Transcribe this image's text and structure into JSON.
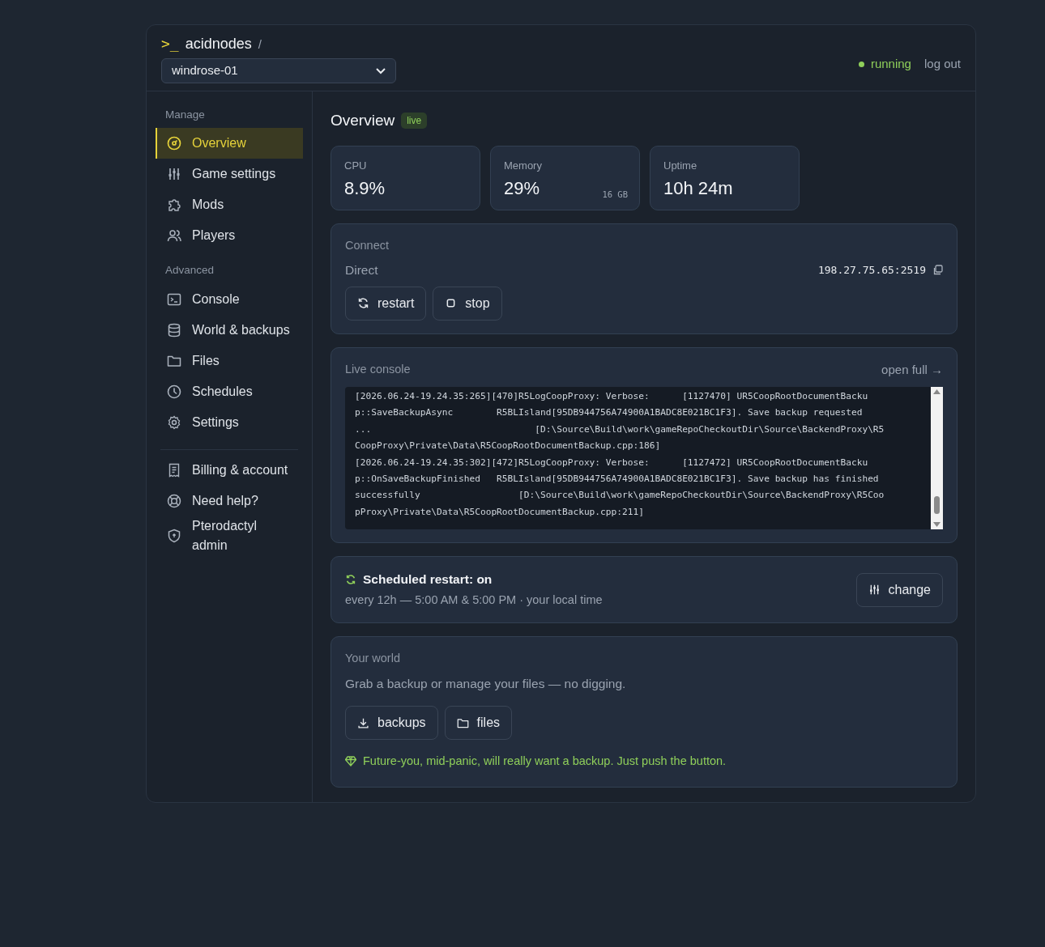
{
  "brand": {
    "prompt": ">_",
    "name": "acidnodes",
    "separator": "/"
  },
  "server_select": {
    "value": "windrose-01"
  },
  "header": {
    "status": "running",
    "logout": "log out"
  },
  "sidebar": {
    "sections": [
      {
        "title": "Manage",
        "items": [
          {
            "label": "Overview",
            "selected": true
          },
          {
            "label": "Game settings",
            "selected": false
          },
          {
            "label": "Mods",
            "selected": false
          },
          {
            "label": "Players",
            "selected": false
          }
        ]
      },
      {
        "title": "Advanced",
        "items": [
          {
            "label": "Console",
            "selected": false
          },
          {
            "label": "World & backups",
            "selected": false
          },
          {
            "label": "Files",
            "selected": false
          },
          {
            "label": "Schedules",
            "selected": false
          },
          {
            "label": "Settings",
            "selected": false
          }
        ]
      },
      {
        "items": [
          {
            "label": "Billing & account",
            "selected": false
          },
          {
            "label": "Need help?",
            "selected": false
          },
          {
            "label": "Pterodactyl admin",
            "selected": false
          }
        ]
      }
    ]
  },
  "overview": {
    "title": "Overview",
    "badge": "live",
    "stats": [
      {
        "label": "CPU",
        "value": "8.9%"
      },
      {
        "label": "Memory",
        "value": "29%",
        "note": "16 GB"
      },
      {
        "label": "Uptime",
        "value": "10h 24m"
      }
    ]
  },
  "connect": {
    "title": "Connect",
    "label": "Direct",
    "address": "198.27.75.65:2519",
    "buttons": [
      {
        "label": "restart"
      },
      {
        "label": "stop"
      }
    ]
  },
  "console": {
    "title": "Live console",
    "link": "open full →",
    "lines": [
      "[2026.06.24-19.24.35:265][470]R5LogCoopProxy: Verbose:      [1127470] UR5CoopRootDocumentBacku",
      "p::SaveBackupAsync        R5BLIsland[95DB944756A74900A1BADC8E021BC1F3]. Save backup requested",
      "...                              [D:\\Source\\Build\\work\\gameRepoCheckoutDir\\Source\\BackendProxy\\R5",
      "CoopProxy\\Private\\Data\\R5CoopRootDocumentBackup.cpp:186]",
      "[2026.06.24-19.24.35:302][472]R5LogCoopProxy: Verbose:      [1127472] UR5CoopRootDocumentBacku",
      "p::OnSaveBackupFinished   R5BLIsland[95DB944756A74900A1BADC8E021BC1F3]. Save backup has finished",
      "successfully                  [D:\\Source\\Build\\work\\gameRepoCheckoutDir\\Source\\BackendProxy\\R5Coo",
      "pProxy\\Private\\Data\\R5CoopRootDocumentBackup.cpp:211]"
    ]
  },
  "schedule": {
    "title": "Scheduled restart: on",
    "detail": "every 12h — 5:00 AM & 5:00 PM · your local time",
    "button": {
      "label": "change"
    }
  },
  "world": {
    "title": "Your world",
    "text": "Grab a backup or manage your files — no digging.",
    "buttons": [
      {
        "label": "backups"
      },
      {
        "label": "files"
      }
    ],
    "tip": "Future-you, mid-panic, will really want a backup. Just push the button."
  }
}
